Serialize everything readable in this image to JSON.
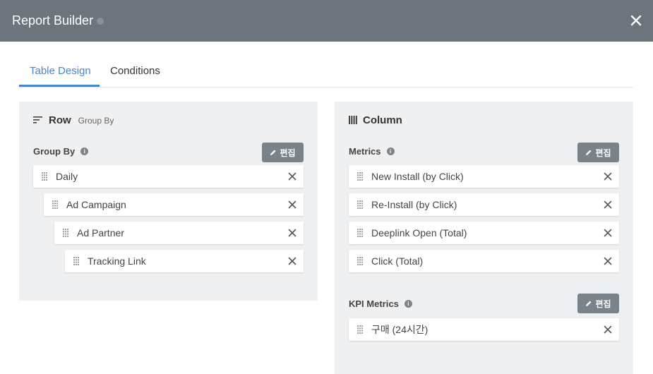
{
  "header": {
    "title": "Report Builder"
  },
  "tabs": [
    {
      "label": "Table Design",
      "active": true
    },
    {
      "label": "Conditions",
      "active": false
    }
  ],
  "row_panel": {
    "title": "Row",
    "subtitle": "Group By",
    "section_label": "Group By",
    "edit_label": "편집",
    "items": [
      {
        "label": "Daily"
      },
      {
        "label": "Ad Campaign"
      },
      {
        "label": "Ad Partner"
      },
      {
        "label": "Tracking Link"
      }
    ]
  },
  "column_panel": {
    "title": "Column",
    "metrics_label": "Metrics",
    "metrics_edit_label": "편집",
    "metrics": [
      {
        "label": "New Install (by Click)"
      },
      {
        "label": "Re-Install (by Click)"
      },
      {
        "label": "Deeplink Open (Total)"
      },
      {
        "label": "Click (Total)"
      }
    ],
    "kpi_label": "KPI Metrics",
    "kpi_edit_label": "편집",
    "kpi_metrics": [
      {
        "label": "구매 (24시간)"
      }
    ]
  },
  "colors": {
    "header_bg": "#6d747c",
    "accent": "#4a86d0",
    "panel_bg": "#eff0f2",
    "edit_button_bg": "#7a828a"
  },
  "icons": {
    "close": "close-icon",
    "info": "info-icon",
    "row_title": "sort-lines-icon",
    "column_title": "columns-icon",
    "edit": "pencil-icon",
    "drag": "drag-handle-icon",
    "remove": "remove-icon"
  }
}
